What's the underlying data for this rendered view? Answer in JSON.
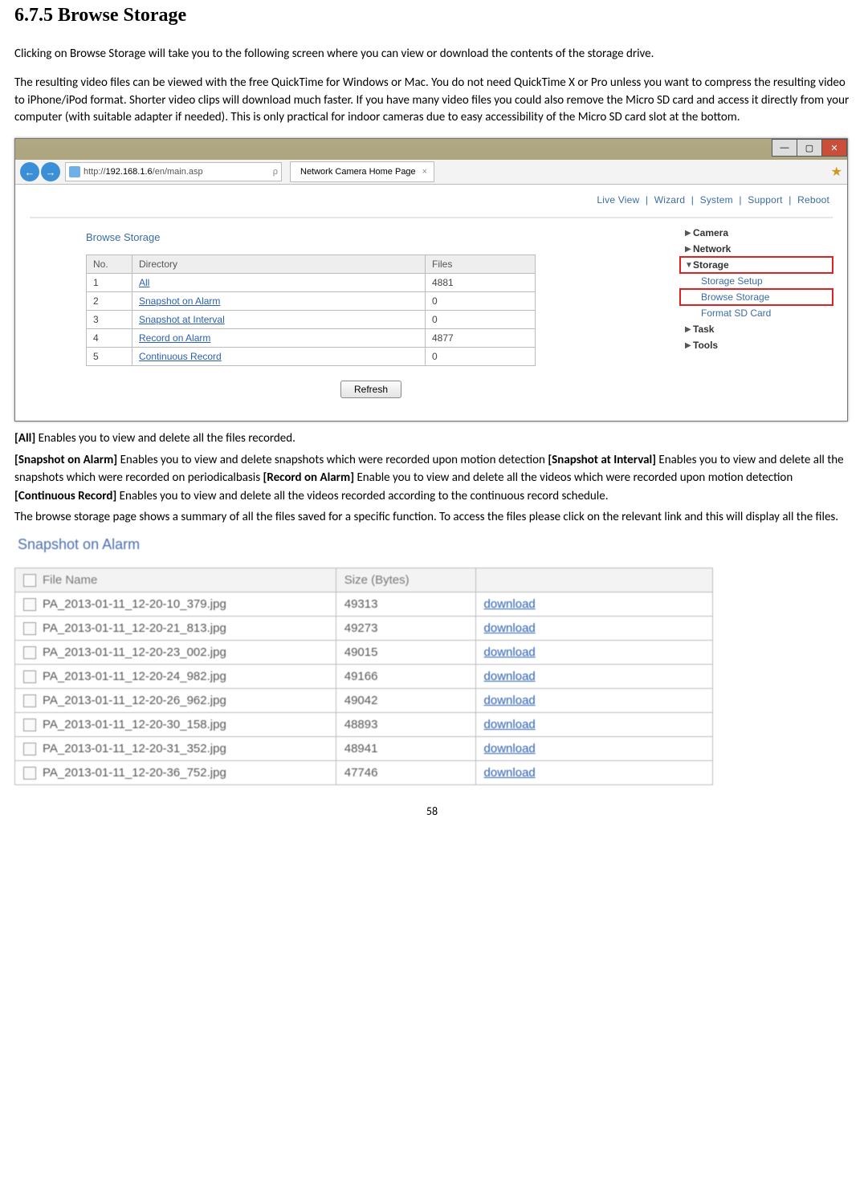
{
  "heading": "6.7.5    Browse Storage",
  "para1": "Clicking on Browse Storage will take you to the following screen where you can view or download the contents of the storage drive.",
  "para2": "The resulting video files can be viewed with the free QuickTime for Windows or Mac. You do not need QuickTime X or Pro unless you want to compress the resulting video to iPhone/iPod format. Shorter video clips will download much faster. If you have many video files you could also remove the Micro SD card and access it directly from your computer (with suitable adapter if needed). This is only practical for indoor cameras due to easy accessibility of the Micro SD card slot at the bottom.",
  "browser": {
    "url_prefix": "http://",
    "url_host": "192.168.1.6",
    "url_path": "/en/main.asp",
    "search_hint": "ρ",
    "tab_title": "Network Camera Home Page",
    "nav_back": "←",
    "nav_fwd": "→",
    "min": "—",
    "max": "▢",
    "close": "✕"
  },
  "camera": {
    "topnav": [
      "Live View",
      "Wizard",
      "System",
      "Support",
      "Reboot"
    ],
    "panel_title": "Browse Storage",
    "headers": {
      "no": "No.",
      "dir": "Directory",
      "files": "Files"
    },
    "rows": [
      {
        "no": "1",
        "dir": "All",
        "files": "4881"
      },
      {
        "no": "2",
        "dir": "Snapshot on Alarm",
        "files": "0"
      },
      {
        "no": "3",
        "dir": "Snapshot at Interval",
        "files": "0"
      },
      {
        "no": "4",
        "dir": "Record on Alarm",
        "files": "4877"
      },
      {
        "no": "5",
        "dir": "Continuous Record",
        "files": "0"
      }
    ],
    "refresh": "Refresh",
    "side": {
      "camera": "Camera",
      "network": "Network",
      "storage": "Storage",
      "storage_sub": [
        "Storage Setup",
        "Browse Storage",
        "Format SD Card"
      ],
      "task": "Task",
      "tools": "Tools"
    }
  },
  "desc": {
    "l1a": "[All] ",
    "l1b": "Enables you to view and delete all the files recorded.",
    "l2a": "[Snapshot on Alarm] ",
    "l2b": "Enables you to view and delete snapshots which were recorded upon motion detection ",
    "l2c": "[Snapshot at Interval] ",
    "l2d": "Enables you to view and delete all the snapshots which were recorded on periodicalbasis ",
    "l2e": "[Record on Alarm] ",
    "l2f": "Enable you to view and delete all the videos which were recorded upon motion detection ",
    "l2g": "[Continuous Record] ",
    "l2h": "Enables you to view and delete all the videos recorded according to the continuous record schedule.",
    "l3": "The browse storage page shows a summary of all the files saved for a specific function. To access the files please click on the relevant link and this will display all the files."
  },
  "snap": {
    "title": "Snapshot on Alarm",
    "headers": {
      "name": "File Name",
      "size": "Size (Bytes)",
      "dl": ""
    },
    "download": "download",
    "rows": [
      {
        "name": "PA_2013-01-11_12-20-10_379.jpg",
        "size": "49313"
      },
      {
        "name": "PA_2013-01-11_12-20-21_813.jpg",
        "size": "49273"
      },
      {
        "name": "PA_2013-01-11_12-20-23_002.jpg",
        "size": "49015"
      },
      {
        "name": "PA_2013-01-11_12-20-24_982.jpg",
        "size": "49166"
      },
      {
        "name": "PA_2013-01-11_12-20-26_962.jpg",
        "size": "49042"
      },
      {
        "name": "PA_2013-01-11_12-20-30_158.jpg",
        "size": "48893"
      },
      {
        "name": "PA_2013-01-11_12-20-31_352.jpg",
        "size": "48941"
      },
      {
        "name": "PA_2013-01-11_12-20-36_752.jpg",
        "size": "47746"
      }
    ]
  },
  "page_number": "58"
}
